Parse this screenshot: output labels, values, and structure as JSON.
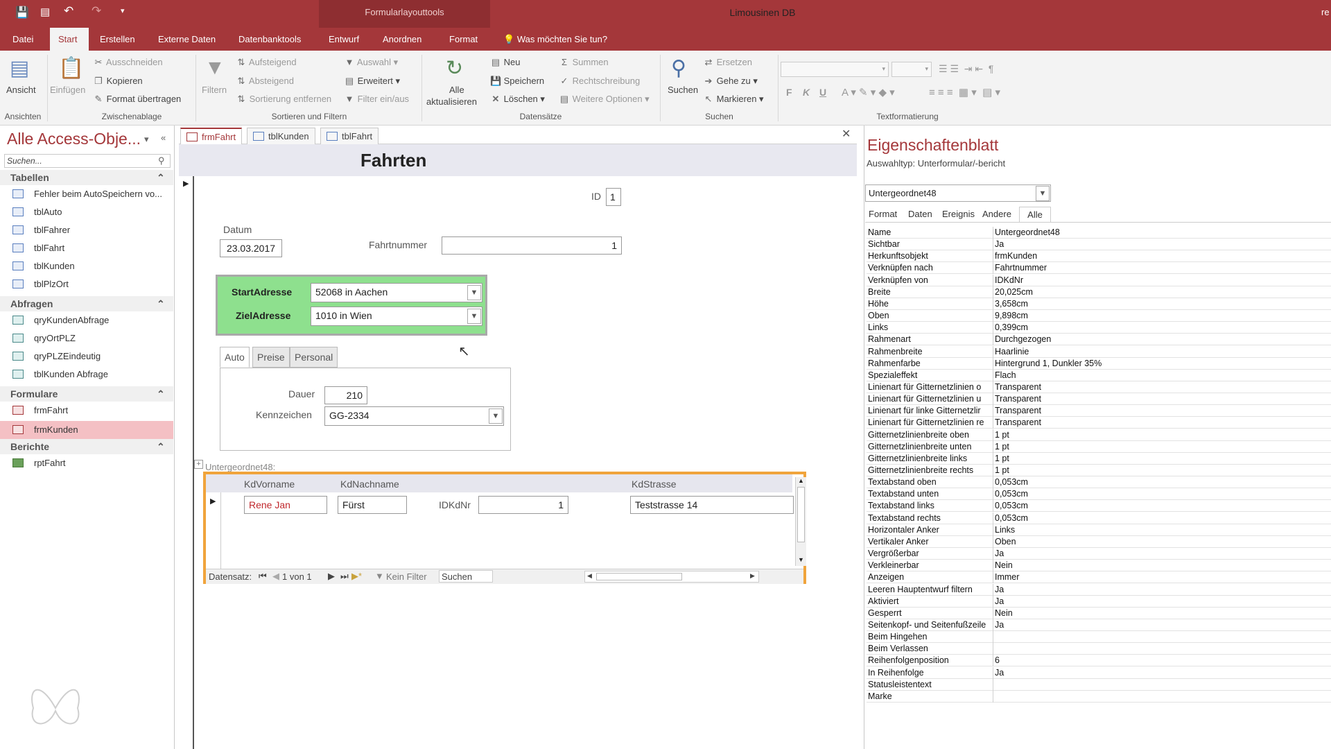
{
  "titlebar": {
    "context_tools": "Formularlayouttools",
    "app_title": "Limousinen DB",
    "user": "re"
  },
  "ribbon_tabs": [
    {
      "label": "Datei"
    },
    {
      "label": "Start"
    },
    {
      "label": "Erstellen"
    },
    {
      "label": "Externe Daten"
    },
    {
      "label": "Datenbanktools"
    },
    {
      "label": "Entwurf"
    },
    {
      "label": "Anordnen"
    },
    {
      "label": "Format"
    }
  ],
  "tell_me": "Was möchten Sie tun?",
  "ribbon": {
    "ansicht": "Ansicht",
    "einfuegen": "Einfügen",
    "ausschneiden": "Ausschneiden",
    "kopieren": "Kopieren",
    "format_uebertragen": "Format übertragen",
    "filtern": "Filtern",
    "aufsteigend": "Aufsteigend",
    "absteigend": "Absteigend",
    "sortierung_entfernen": "Sortierung entfernen",
    "auswahl": "Auswahl",
    "erweitert": "Erweitert",
    "filter_einaus": "Filter ein/aus",
    "alle_aktualisieren_1": "Alle",
    "alle_aktualisieren_2": "aktualisieren",
    "neu": "Neu",
    "speichern": "Speichern",
    "loeschen": "Löschen",
    "summen": "Summen",
    "rechtschreibung": "Rechtschreibung",
    "weitere_optionen": "Weitere Optionen",
    "suchen": "Suchen",
    "ersetzen": "Ersetzen",
    "gehe_zu": "Gehe zu",
    "markieren": "Markieren",
    "groups": {
      "ansichten": "Ansichten",
      "zwischenablage": "Zwischenablage",
      "sortieren": "Sortieren und Filtern",
      "datensaetze": "Datensätze",
      "suchen": "Suchen",
      "textformatierung": "Textformatierung"
    }
  },
  "nav": {
    "title": "Alle Access-Obje...",
    "search_placeholder": "Suchen...",
    "sections": [
      {
        "label": "Tabellen"
      },
      {
        "label": "Abfragen"
      },
      {
        "label": "Formulare"
      },
      {
        "label": "Berichte"
      }
    ],
    "tables": [
      "Fehler beim AutoSpeichern vo...",
      "tblAuto",
      "tblFahrer",
      "tblFahrt",
      "tblKunden",
      "tblPlzOrt"
    ],
    "queries": [
      "qryKundenAbfrage",
      "qryOrtPLZ",
      "qryPLZEindeutig",
      "tblKunden Abfrage"
    ],
    "forms": [
      "frmFahrt",
      "frmKunden"
    ],
    "reports": [
      "rptFahrt"
    ]
  },
  "doc_tabs": [
    "frmFahrt",
    "tblKunden",
    "tblFahrt"
  ],
  "form": {
    "title": "Fahrten",
    "id_label": "ID",
    "id_value": "1",
    "datum_label": "Datum",
    "datum_value": "23.03.2017",
    "fahrtnummer_label": "Fahrtnummer",
    "fahrtnummer_value": "1",
    "start_label": "StartAdresse",
    "start_value": "52068 in Aachen",
    "ziel_label": "ZielAdresse",
    "ziel_value": "1010 in Wien",
    "tabs": [
      "Auto",
      "Preise",
      "Personal"
    ],
    "dauer_label": "Dauer",
    "dauer_value": "210",
    "kennzeichen_label": "Kennzeichen",
    "kennzeichen_value": "GG-2334",
    "subform_label": "Untergeordnet48:",
    "sub_headers": [
      "KdVorname",
      "KdNachname",
      "KdStrasse"
    ],
    "sub_row": {
      "vorname": "Rene Jan",
      "nachname": "Fürst",
      "idkdnr_label": "IDKdNr",
      "idkdnr": "1",
      "strasse": "Teststrasse 14"
    },
    "subnav": {
      "label": "Datensatz:",
      "pos": "1 von 1",
      "filter": "Kein Filter",
      "search": "Suchen"
    }
  },
  "props": {
    "title": "Eigenschaftenblatt",
    "subtitle": "Auswahltyp:  Unterformular/-bericht",
    "selected": "Untergeordnet48",
    "tabs": [
      "Format",
      "Daten",
      "Ereignis",
      "Andere",
      "Alle"
    ],
    "rows": [
      [
        "Name",
        "Untergeordnet48"
      ],
      [
        "Sichtbar",
        "Ja"
      ],
      [
        "Herkunftsobjekt",
        "frmKunden"
      ],
      [
        "Verknüpfen nach",
        "Fahrtnummer"
      ],
      [
        "Verknüpfen von",
        "IDKdNr"
      ],
      [
        "Breite",
        "20,025cm"
      ],
      [
        "Höhe",
        "3,658cm"
      ],
      [
        "Oben",
        "9,898cm"
      ],
      [
        "Links",
        "0,399cm"
      ],
      [
        "Rahmenart",
        "Durchgezogen"
      ],
      [
        "Rahmenbreite",
        "Haarlinie"
      ],
      [
        "Rahmenfarbe",
        "Hintergrund 1, Dunkler 35%"
      ],
      [
        "Spezialeffekt",
        "Flach"
      ],
      [
        "Linienart für Gitternetzlinien o",
        "Transparent"
      ],
      [
        "Linienart für Gitternetzlinien u",
        "Transparent"
      ],
      [
        "Linienart für linke Gitternetzlir",
        "Transparent"
      ],
      [
        "Linienart für Gitternetzlinien re",
        "Transparent"
      ],
      [
        "Gitternetzlinienbreite oben",
        "1 pt"
      ],
      [
        "Gitternetzlinienbreite unten",
        "1 pt"
      ],
      [
        "Gitternetzlinienbreite links",
        "1 pt"
      ],
      [
        "Gitternetzlinienbreite rechts",
        "1 pt"
      ],
      [
        "Textabstand oben",
        "0,053cm"
      ],
      [
        "Textabstand unten",
        "0,053cm"
      ],
      [
        "Textabstand links",
        "0,053cm"
      ],
      [
        "Textabstand rechts",
        "0,053cm"
      ],
      [
        "Horizontaler Anker",
        "Links"
      ],
      [
        "Vertikaler Anker",
        "Oben"
      ],
      [
        "Vergrößerbar",
        "Ja"
      ],
      [
        "Verkleinerbar",
        "Nein"
      ],
      [
        "Anzeigen",
        "Immer"
      ],
      [
        "Leeren Hauptentwurf filtern",
        "Ja"
      ],
      [
        "Aktiviert",
        "Ja"
      ],
      [
        "Gesperrt",
        "Nein"
      ],
      [
        "Seitenkopf- und Seitenfußzeile",
        "Ja"
      ],
      [
        "Beim Hingehen",
        ""
      ],
      [
        "Beim Verlassen",
        ""
      ],
      [
        "Reihenfolgenposition",
        "6"
      ],
      [
        "In Reihenfolge",
        "Ja"
      ],
      [
        "Statusleistentext",
        ""
      ],
      [
        "Marke",
        ""
      ]
    ]
  },
  "colors": {
    "accent": "#a4373a",
    "address_box": "#8ee08e",
    "subform_border": "#f0a43c"
  },
  "icons": [
    "save-icon",
    "undo-icon",
    "redo-icon",
    "lightbulb-icon",
    "search-icon",
    "close-icon",
    "chevron-down-icon",
    "table-icon",
    "query-icon",
    "form-icon",
    "report-icon"
  ]
}
